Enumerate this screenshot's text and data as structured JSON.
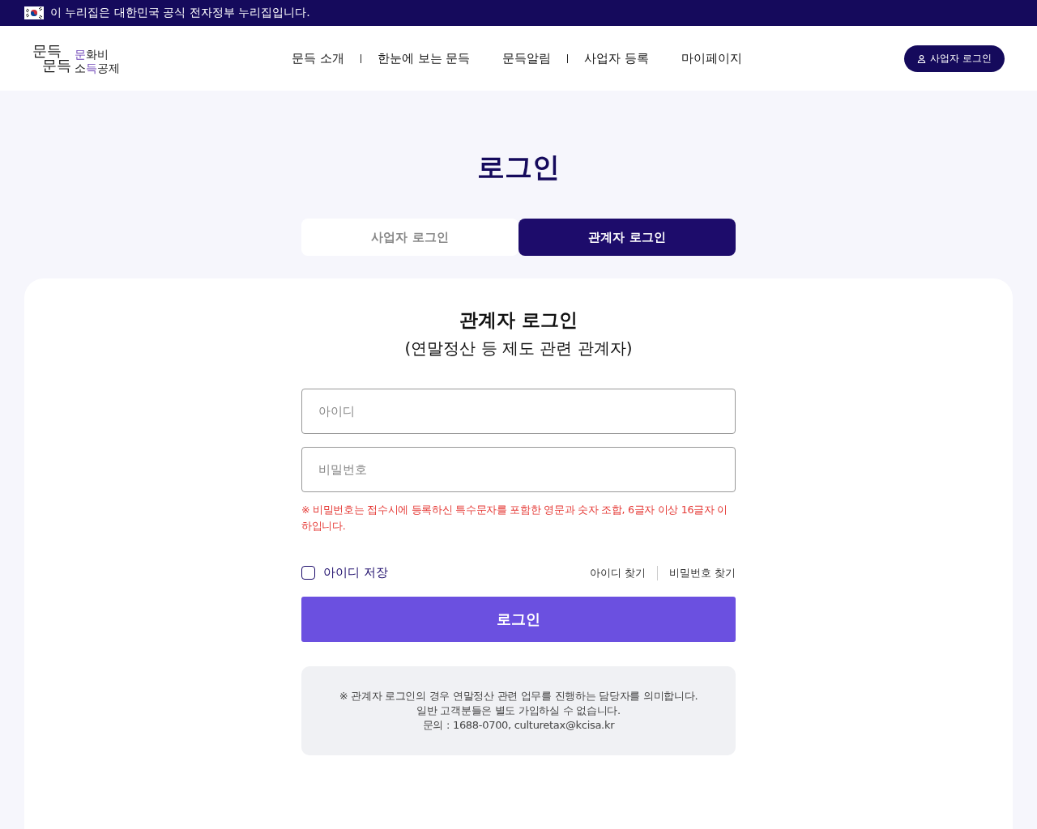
{
  "gov_banner": {
    "text": "이 누리집은 대한민국 공식 전자정부 누리집입니다."
  },
  "logo": {
    "mark_lines": [
      "문득",
      "문득"
    ],
    "caption_lines": [
      [
        {
          "text": "문",
          "accent": true
        },
        {
          "text": "화비",
          "accent": false
        }
      ],
      [
        {
          "text": "소",
          "accent": false
        },
        {
          "text": "득",
          "accent": true
        },
        {
          "text": "공제",
          "accent": false
        }
      ]
    ]
  },
  "nav": [
    {
      "label": "문득 소개",
      "divider_after": true
    },
    {
      "label": "한눈에 보는 문득",
      "divider_after": false
    },
    {
      "label": "문득알림",
      "divider_after": true
    },
    {
      "label": "사업자 등록",
      "divider_after": false
    },
    {
      "label": "마이페이지",
      "divider_after": false
    }
  ],
  "header_button": "사업자 로그인",
  "page_title": "로그인",
  "tabs": [
    {
      "label": "사업자 로그인",
      "selected": false
    },
    {
      "label": "관계자 로그인",
      "selected": true
    }
  ],
  "form": {
    "title": "관계자 로그인",
    "subtitle": "(연말정산 등 제도 관련 관계자)",
    "id_field": {
      "placeholder": "아이디"
    },
    "password_field": {
      "placeholder": "비밀번호"
    },
    "password_hint": "※ 비밀번호는 접수시에 등록하신 특수문자를 포함한 영문과 숫자 조합, 6글자 이상 16글자 이하입니다.",
    "save_id": {
      "label": "아이디 저장",
      "checked": false
    },
    "links": [
      "아이디 찾기",
      "비밀번호 찾기"
    ],
    "submit": "로그인",
    "notice_lines": [
      "※ 관계자 로그인의 경우 연말정산 관련 업무를 진행하는 담당자를 의미합니다.",
      "일반 고객분들은 별도 가입하실 수 없습니다.",
      "문의 : 1688-0700, culturetax@kcisa.kr"
    ]
  }
}
